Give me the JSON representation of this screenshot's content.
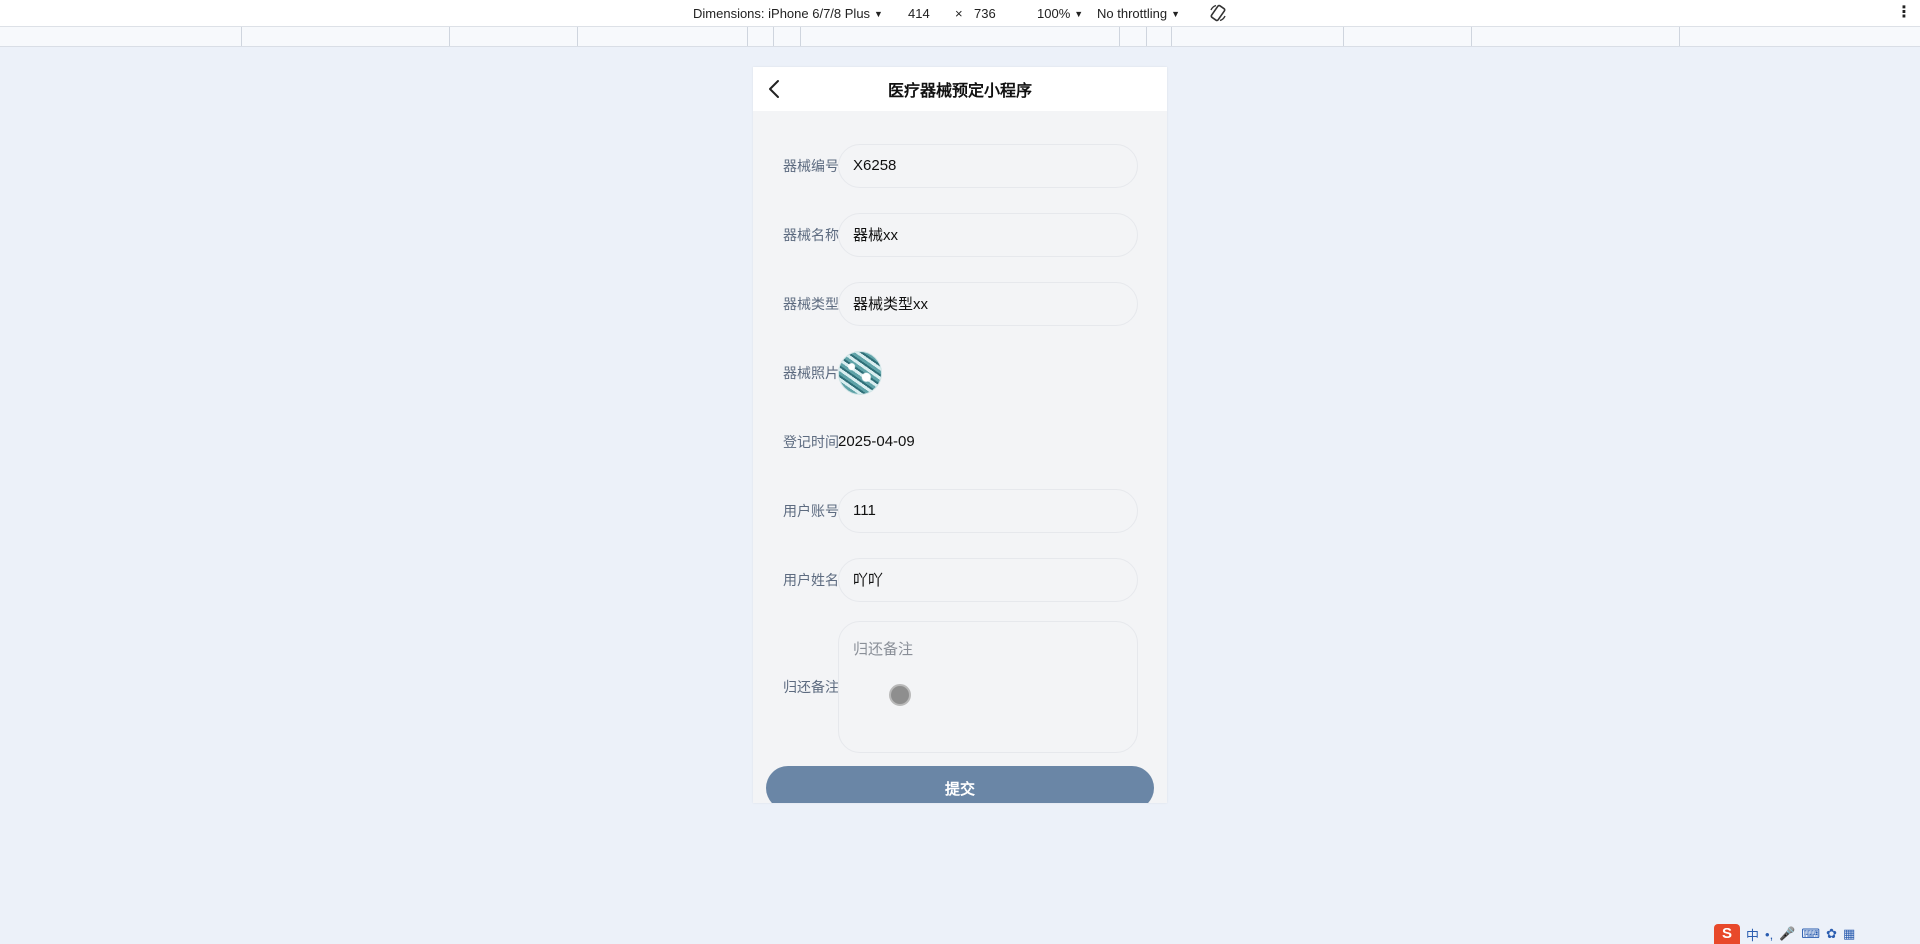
{
  "devtools": {
    "device_label": "Dimensions: iPhone 6/7/8 Plus",
    "width": "414",
    "times": "×",
    "height": "736",
    "zoom": "100%",
    "throttling": "No throttling",
    "more": "⋮"
  },
  "app": {
    "title": "医疗器械预定小程序"
  },
  "form": {
    "device_no": {
      "label": "器械编号",
      "value": "X6258"
    },
    "device_name": {
      "label": "器械名称",
      "value": "器械xx"
    },
    "device_type": {
      "label": "器械类型",
      "value": "器械类型xx"
    },
    "device_photo": {
      "label": "器械照片"
    },
    "register_time": {
      "label": "登记时间",
      "value": "2025-04-09"
    },
    "user_account": {
      "label": "用户账号",
      "value": "111"
    },
    "user_name": {
      "label": "用户姓名",
      "value": "吖吖"
    },
    "return_note": {
      "label": "归还备注",
      "placeholder": "归还备注"
    },
    "submit_label": "提交"
  },
  "ime": {
    "logo": "S",
    "lang": "中"
  }
}
